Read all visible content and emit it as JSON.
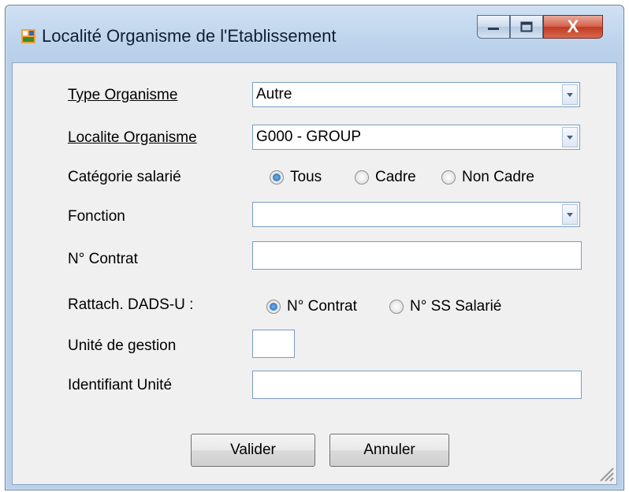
{
  "window": {
    "title": "Localité Organisme de l'Etablissement",
    "minimize_icon": "minimize-icon",
    "maximize_icon": "maximize-icon",
    "close_label": "X"
  },
  "form": {
    "type_organisme_label": "Type Organisme",
    "type_organisme_value": "Autre",
    "localite_label": "Localite Organisme",
    "localite_value": "G000 - GROUP",
    "categorie_label": "Catégorie salarié",
    "categorie_options": [
      "Tous",
      "Cadre",
      "Non Cadre"
    ],
    "categorie_selected": "Tous",
    "fonction_label": "Fonction",
    "fonction_value": "",
    "contrat_label": "N° Contrat",
    "contrat_value": "",
    "rattach_label": "Rattach. DADS-U :",
    "rattach_options": [
      "N° Contrat",
      "N° SS Salarié"
    ],
    "rattach_selected": "N° Contrat",
    "unite_gestion_label": "Unité de gestion",
    "unite_gestion_value": "",
    "identifiant_label": "Identifiant Unité",
    "identifiant_value": ""
  },
  "buttons": {
    "valider": "Valider",
    "annuler": "Annuler"
  }
}
